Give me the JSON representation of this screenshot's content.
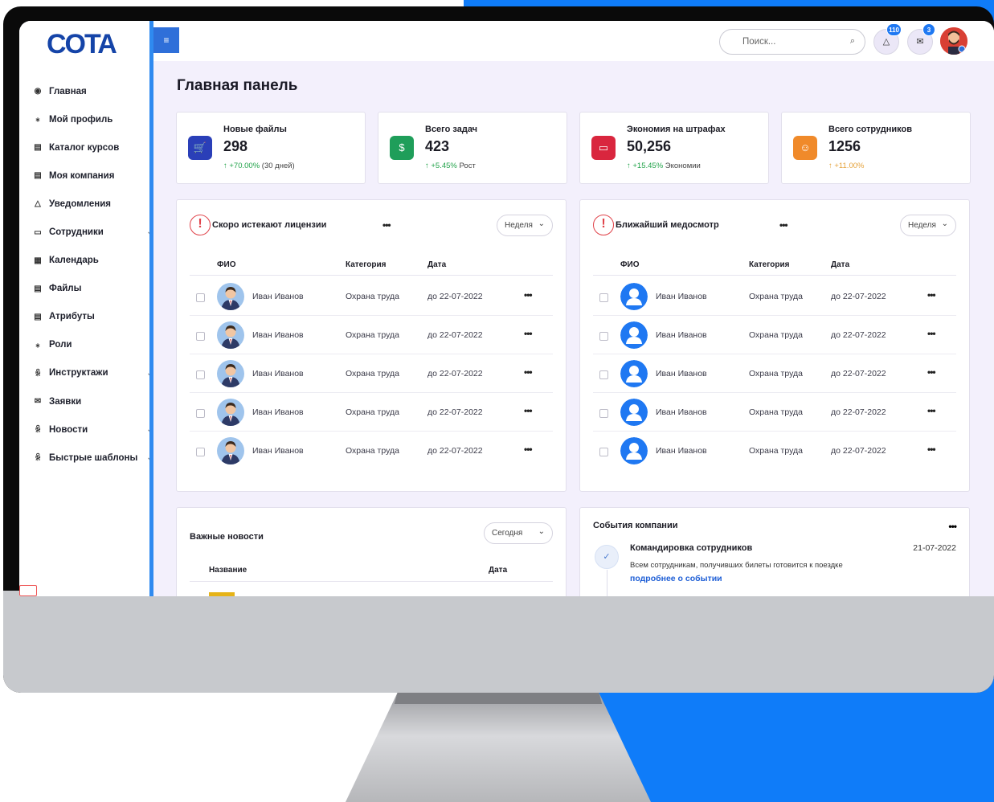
{
  "colors": {
    "accent": "#1f78f2",
    "sidebar_edge": "#2f8af0",
    "danger": "#e0434a",
    "success": "#22a34a"
  },
  "logo": {
    "text": "COTA"
  },
  "sidebar": {
    "items": [
      {
        "icon": "home-icon",
        "label": "Главная",
        "glyph": "◉"
      },
      {
        "icon": "user-icon",
        "label": "Мой профиль",
        "glyph": "⁎"
      },
      {
        "icon": "book-icon",
        "label": "Каталог курсов",
        "glyph": "▤"
      },
      {
        "icon": "building-icon",
        "label": "Моя компания",
        "glyph": "▤"
      },
      {
        "icon": "bell-icon",
        "label": "Уведомления",
        "glyph": "△"
      },
      {
        "icon": "people-icon",
        "label": "Сотрудники",
        "glyph": "▭",
        "chev": true
      },
      {
        "icon": "calendar-icon",
        "label": "Календарь",
        "glyph": "▦"
      },
      {
        "icon": "file-icon",
        "label": "Файлы",
        "glyph": "▤"
      },
      {
        "icon": "tag-icon",
        "label": "Атрибуты",
        "glyph": "▤"
      },
      {
        "icon": "roles-icon",
        "label": "Роли",
        "glyph": "⁎"
      },
      {
        "icon": "instruct-icon",
        "label": "Инструктажи",
        "glyph": "ꆜ",
        "chev": true
      },
      {
        "icon": "mail-icon",
        "label": "Заявки",
        "glyph": "✉"
      },
      {
        "icon": "news-icon",
        "label": "Новости",
        "glyph": "ꆜ",
        "chev": true
      },
      {
        "icon": "template-icon",
        "label": "Быстрые шаблоны",
        "glyph": "ꆜ",
        "chev": true
      }
    ]
  },
  "topbar": {
    "search_placeholder": "Поиск...",
    "notifications_count": "110",
    "messages_count": "3"
  },
  "page_title": "Главная панель",
  "stats": [
    {
      "label": "Новые файлы",
      "value": "298",
      "delta": "↑ +70.00%",
      "note": " (30 дней)",
      "color": "#2a3fb8",
      "glyph": "🛒"
    },
    {
      "label": "Всего задач",
      "value": "423",
      "delta": "↑ +5.45%",
      "note": " Рост",
      "color": "#1f9e5a",
      "glyph": "$"
    },
    {
      "label": "Экономия на штрафах",
      "value": "50,256",
      "delta": "↑ +15.45%",
      "note": " Экономии",
      "color": "#d9263e",
      "glyph": "▭"
    },
    {
      "label": "Всего сотрудников",
      "value": "1256",
      "delta": "↑ +11.00%",
      "note": "",
      "color": "#f08a2a",
      "glyph": "☺"
    }
  ],
  "licenses": {
    "title": "Скоро истекают лицензии",
    "filter": "Неделя",
    "headers": {
      "name": "ФИО",
      "category": "Категория",
      "date": "Дата"
    },
    "rows": [
      {
        "name": "Иван Иванов",
        "category": "Охрана труда",
        "date": "до 22-07-2022"
      },
      {
        "name": "Иван Иванов",
        "category": "Охрана труда",
        "date": "до 22-07-2022"
      },
      {
        "name": "Иван Иванов",
        "category": "Охрана труда",
        "date": "до 22-07-2022"
      },
      {
        "name": "Иван Иванов",
        "category": "Охрана труда",
        "date": "до 22-07-2022"
      },
      {
        "name": "Иван Иванов",
        "category": "Охрана труда",
        "date": "до 22-07-2022"
      }
    ]
  },
  "medical": {
    "title": "Ближайший медосмотр",
    "filter": "Неделя",
    "headers": {
      "name": "ФИО",
      "category": "Категория",
      "date": "Дата"
    },
    "rows": [
      {
        "name": "Иван Иванов",
        "category": "Охрана труда",
        "date": "до 22-07-2022"
      },
      {
        "name": "Иван Иванов",
        "category": "Охрана труда",
        "date": "до 22-07-2022"
      },
      {
        "name": "Иван Иванов",
        "category": "Охрана труда",
        "date": "до 22-07-2022"
      },
      {
        "name": "Иван Иванов",
        "category": "Охрана труда",
        "date": "до 22-07-2022"
      },
      {
        "name": "Иван Иванов",
        "category": "Охрана труда",
        "date": "до 22-07-2022"
      }
    ]
  },
  "news": {
    "title": "Важные новости",
    "filter": "Сегодня",
    "col_name": "Название",
    "col_date": "Дата"
  },
  "events": {
    "title": "События компании",
    "item_name": "Командировка сотрудников",
    "item_date": "21-07-2022",
    "item_desc": "Всем сотрудникам, получивших билеты готовится к поездке",
    "item_link": "подробнее о событии"
  }
}
